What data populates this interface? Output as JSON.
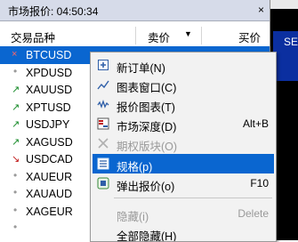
{
  "panel": {
    "title": "市场报价: 04:50:34",
    "close": "×",
    "columns": {
      "symbol": "交易品种",
      "bid": "卖价",
      "bid_sort": "▼",
      "ask": "买价"
    }
  },
  "symbols": [
    {
      "name": "BTCUSD",
      "trend": "down",
      "icon": "×",
      "selected": true
    },
    {
      "name": "XPDUSD",
      "trend": "none",
      "icon": "•"
    },
    {
      "name": "XAUUSD",
      "trend": "up",
      "icon": "↗"
    },
    {
      "name": "XPTUSD",
      "trend": "up",
      "icon": "↗"
    },
    {
      "name": "USDJPY",
      "trend": "up",
      "icon": "↗"
    },
    {
      "name": "XAGUSD",
      "trend": "up",
      "icon": "↗"
    },
    {
      "name": "USDCAD",
      "trend": "down",
      "icon": "↘"
    },
    {
      "name": "XAUEUR",
      "trend": "none",
      "icon": "•"
    },
    {
      "name": "XAUAUD",
      "trend": "none",
      "icon": "•"
    },
    {
      "name": "XAGEUR",
      "trend": "none",
      "icon": "•"
    },
    {
      "name": "",
      "trend": "none",
      "icon": "•"
    }
  ],
  "chart": {
    "label": "SE"
  },
  "context_menu": {
    "items": [
      {
        "label": "新订单(N)",
        "shortcut": "",
        "icon": "plus-icon"
      },
      {
        "label": "图表窗口(C)",
        "shortcut": "",
        "icon": "chart-window-icon"
      },
      {
        "label": "报价图表(T)",
        "shortcut": "",
        "icon": "tick-chart-icon"
      },
      {
        "label": "市场深度(D)",
        "shortcut": "Alt+B",
        "icon": "depth-icon"
      },
      {
        "label": "期权版块(O)",
        "shortcut": "",
        "icon": "options-icon",
        "disabled": true
      },
      {
        "label": "规格(p)",
        "shortcut": "",
        "icon": "spec-icon",
        "active": true
      },
      {
        "label": "弹出报价(o)",
        "shortcut": "F10",
        "icon": "popup-icon"
      },
      {
        "label": "隐藏(i)",
        "shortcut": "Delete",
        "icon": "",
        "disabled": true
      },
      {
        "label": "全部隐藏(H)",
        "shortcut": "",
        "icon": ""
      }
    ]
  },
  "colors": {
    "selection": "#0a66d0",
    "up": "#1a8c2b",
    "down": "#c01818"
  }
}
